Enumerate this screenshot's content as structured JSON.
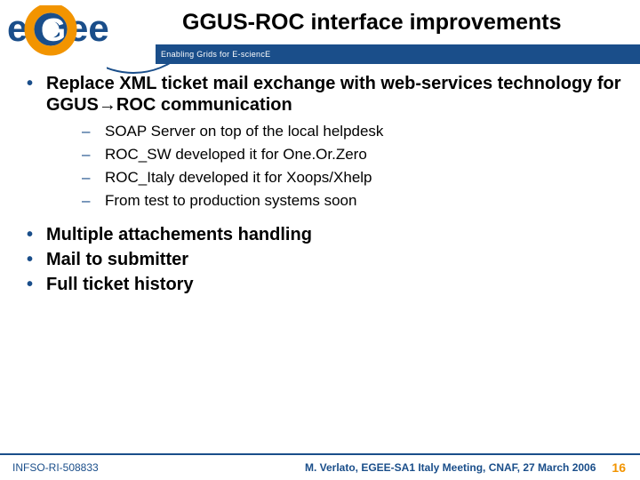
{
  "header": {
    "title": "GGUS-ROC interface improvements",
    "subtitle": "Enabling Grids for E-sciencE",
    "logo_text_1": "e",
    "logo_text_2": "ee",
    "logo_text_g": "G"
  },
  "content": {
    "bullets": [
      {
        "text": "Replace XML ticket mail exchange with web-services technology for GGUS→ROC communication",
        "sub": [
          "SOAP Server on top of the local helpdesk",
          "ROC_SW developed it for One.Or.Zero",
          "ROC_Italy developed it for Xoops/Xhelp",
          "From test to production systems soon"
        ]
      },
      {
        "text": "Multiple attachements handling",
        "sub": []
      },
      {
        "text": "Mail to submitter",
        "sub": []
      },
      {
        "text": "Full ticket history",
        "sub": []
      }
    ]
  },
  "footer": {
    "left": "INFSO-RI-508833",
    "center": "M. Verlato, EGEE-SA1 Italy Meeting, CNAF, 27 March 2006",
    "right": "16"
  }
}
